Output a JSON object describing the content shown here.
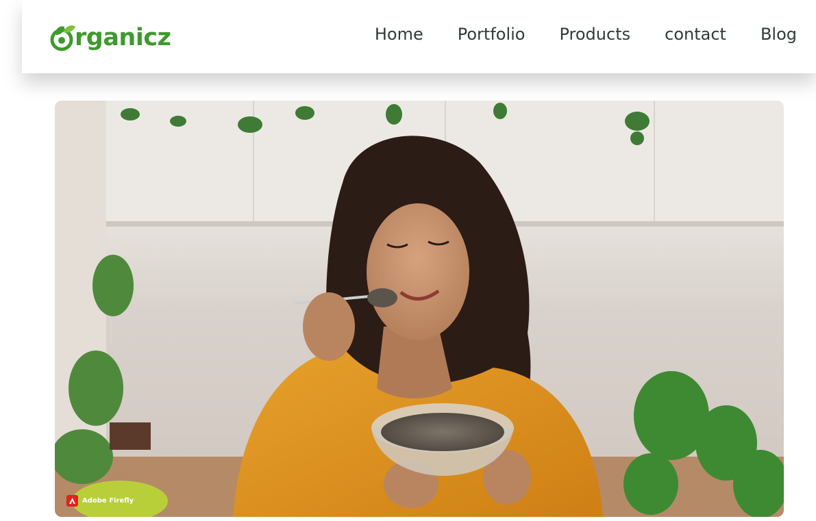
{
  "header": {
    "logo": {
      "text": "rganicz",
      "icon": "leaf-o-logo-icon",
      "color": "#3e9a2c"
    },
    "nav": [
      {
        "label": "Home"
      },
      {
        "label": "Portfolio"
      },
      {
        "label": "Products"
      },
      {
        "label": "contact"
      },
      {
        "label": "Blog"
      }
    ],
    "nav_color": "#2f3b39"
  },
  "hero": {
    "image": "woman-eating-chia-seeds-photo",
    "badge": {
      "icon": "adobe-icon",
      "text": "Adobe Firefly",
      "icon_color": "#e6201f"
    }
  }
}
